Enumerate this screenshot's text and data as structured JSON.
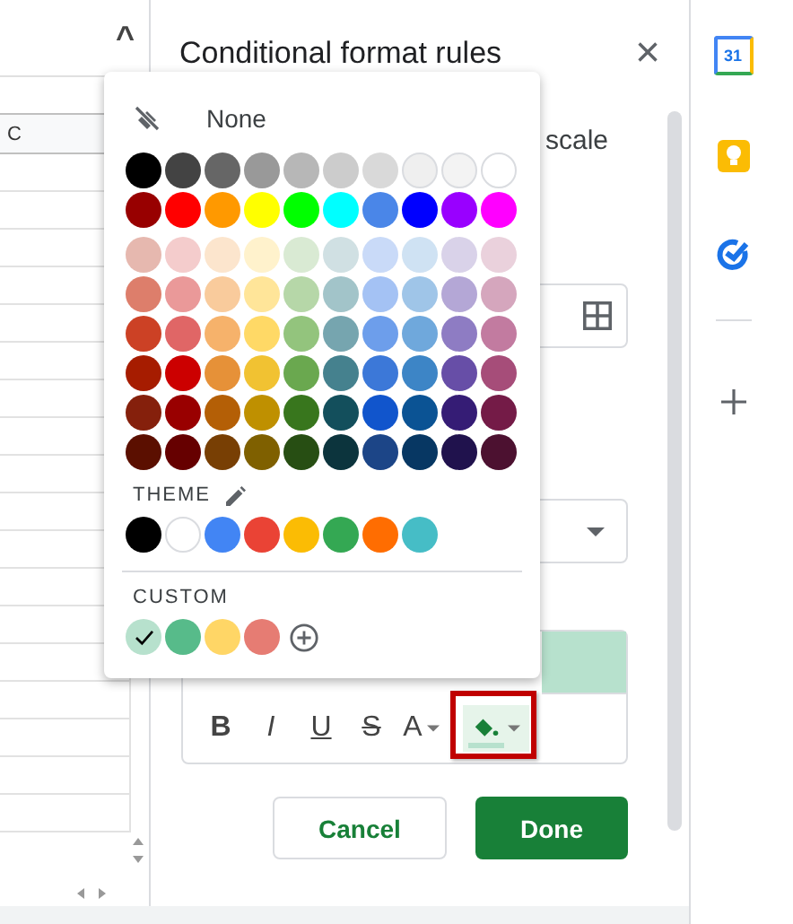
{
  "sheet": {
    "collapse_glyph": "^",
    "column_header": "C"
  },
  "panel": {
    "title": "Conditional format rules",
    "close": "×",
    "partial_label": "scale",
    "toolbar": {
      "buttons": [
        {
          "label": "B",
          "kind": "bold"
        },
        {
          "label": "I",
          "kind": "italic"
        },
        {
          "label": "U",
          "kind": "underline"
        },
        {
          "label": "S",
          "kind": "strike"
        },
        {
          "label": "A",
          "kind": "textcolor"
        }
      ],
      "fill_outlined": true
    },
    "buttons": [
      {
        "label": "Cancel",
        "kind": "secondary"
      },
      {
        "label": "Done",
        "kind": "primary"
      }
    ]
  },
  "palette": {
    "none_label": "None",
    "rows": [
      [
        {
          "color": "#000000",
          "selected": false
        },
        {
          "color": "#434343",
          "selected": false
        },
        {
          "color": "#666666",
          "selected": false
        },
        {
          "color": "#999999",
          "selected": false
        },
        {
          "color": "#b7b7b7",
          "selected": false
        },
        {
          "color": "#cccccc",
          "selected": false
        },
        {
          "color": "#d9d9d9",
          "selected": false
        },
        {
          "color": "#efefef",
          "selected": false
        },
        {
          "color": "#f3f3f3",
          "selected": false
        },
        {
          "color": "#ffffff",
          "selected": false
        }
      ],
      [
        {
          "color": "#980000",
          "selected": false
        },
        {
          "color": "#ff0000",
          "selected": false
        },
        {
          "color": "#ff9900",
          "selected": false
        },
        {
          "color": "#ffff00",
          "selected": false
        },
        {
          "color": "#00ff00",
          "selected": false
        },
        {
          "color": "#00ffff",
          "selected": false
        },
        {
          "color": "#4a86e8",
          "selected": false
        },
        {
          "color": "#0000ff",
          "selected": false
        },
        {
          "color": "#9900ff",
          "selected": false
        },
        {
          "color": "#ff00ff",
          "selected": false
        }
      ],
      [
        {
          "color": "#e6b8af",
          "selected": false
        },
        {
          "color": "#f4cccc",
          "selected": false
        },
        {
          "color": "#fce5cd",
          "selected": false
        },
        {
          "color": "#fff2cc",
          "selected": false
        },
        {
          "color": "#d9ead3",
          "selected": false
        },
        {
          "color": "#d0e0e3",
          "selected": false
        },
        {
          "color": "#c9daf8",
          "selected": false
        },
        {
          "color": "#cfe2f3",
          "selected": false
        },
        {
          "color": "#d9d2e9",
          "selected": false
        },
        {
          "color": "#ead1dc",
          "selected": false
        }
      ],
      [
        {
          "color": "#dd7e6b",
          "selected": false
        },
        {
          "color": "#ea9999",
          "selected": false
        },
        {
          "color": "#f9cb9c",
          "selected": false
        },
        {
          "color": "#ffe599",
          "selected": false
        },
        {
          "color": "#b6d7a8",
          "selected": false
        },
        {
          "color": "#a2c4c9",
          "selected": false
        },
        {
          "color": "#a4c2f4",
          "selected": false
        },
        {
          "color": "#9fc5e8",
          "selected": false
        },
        {
          "color": "#b4a7d6",
          "selected": false
        },
        {
          "color": "#d5a6bd",
          "selected": false
        }
      ],
      [
        {
          "color": "#cc4125",
          "selected": false
        },
        {
          "color": "#e06666",
          "selected": false
        },
        {
          "color": "#f6b26b",
          "selected": false
        },
        {
          "color": "#ffd966",
          "selected": false
        },
        {
          "color": "#93c47d",
          "selected": false
        },
        {
          "color": "#76a5af",
          "selected": false
        },
        {
          "color": "#6d9eeb",
          "selected": false
        },
        {
          "color": "#6fa8dc",
          "selected": false
        },
        {
          "color": "#8e7cc3",
          "selected": false
        },
        {
          "color": "#c27ba0",
          "selected": false
        }
      ],
      [
        {
          "color": "#a61c00",
          "selected": false
        },
        {
          "color": "#cc0000",
          "selected": false
        },
        {
          "color": "#e69138",
          "selected": false
        },
        {
          "color": "#f1c232",
          "selected": false
        },
        {
          "color": "#6aa84f",
          "selected": false
        },
        {
          "color": "#45818e",
          "selected": false
        },
        {
          "color": "#3c78d8",
          "selected": false
        },
        {
          "color": "#3d85c6",
          "selected": false
        },
        {
          "color": "#674ea7",
          "selected": false
        },
        {
          "color": "#a64d79",
          "selected": false
        }
      ],
      [
        {
          "color": "#85200c",
          "selected": false
        },
        {
          "color": "#990000",
          "selected": false
        },
        {
          "color": "#b45f06",
          "selected": false
        },
        {
          "color": "#bf9000",
          "selected": false
        },
        {
          "color": "#38761d",
          "selected": false
        },
        {
          "color": "#134f5c",
          "selected": false
        },
        {
          "color": "#1155cc",
          "selected": false
        },
        {
          "color": "#0b5394",
          "selected": false
        },
        {
          "color": "#351c75",
          "selected": false
        },
        {
          "color": "#741b47",
          "selected": false
        }
      ],
      [
        {
          "color": "#5b0f00",
          "selected": false
        },
        {
          "color": "#660000",
          "selected": false
        },
        {
          "color": "#783f04",
          "selected": false
        },
        {
          "color": "#7f6000",
          "selected": false
        },
        {
          "color": "#274e13",
          "selected": false
        },
        {
          "color": "#0c343d",
          "selected": false
        },
        {
          "color": "#1c4587",
          "selected": false
        },
        {
          "color": "#073763",
          "selected": false
        },
        {
          "color": "#20124d",
          "selected": false
        },
        {
          "color": "#4c1130",
          "selected": false
        }
      ]
    ],
    "theme_label": "THEME",
    "theme": [
      {
        "color": "#000000",
        "selected": false
      },
      {
        "color": "#ffffff",
        "selected": false
      },
      {
        "color": "#4285f4",
        "selected": false
      },
      {
        "color": "#ea4335",
        "selected": false
      },
      {
        "color": "#fbbc04",
        "selected": false
      },
      {
        "color": "#34a853",
        "selected": false
      },
      {
        "color": "#ff6d01",
        "selected": false
      },
      {
        "color": "#46bdc6",
        "selected": false
      }
    ],
    "custom_label": "CUSTOM",
    "custom": [
      {
        "color": "#b7e1cd",
        "selected": true
      },
      {
        "color": "#57bb8a",
        "selected": false
      },
      {
        "color": "#ffd666",
        "selected": false
      },
      {
        "color": "#e67c73",
        "selected": false
      }
    ]
  },
  "side_panel": {
    "calendar_day": "31"
  }
}
